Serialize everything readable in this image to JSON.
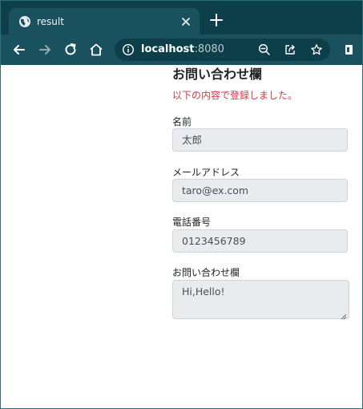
{
  "browser": {
    "tab": {
      "title": "result",
      "favicon": "globe-icon",
      "close_icon": "close-icon"
    },
    "new_tab_icon": "plus-icon",
    "toolbar": {
      "back_icon": "arrow-left-icon",
      "forward_icon": "arrow-right-icon",
      "reload_icon": "reload-icon",
      "home_icon": "home-icon",
      "info_icon": "info-icon",
      "url_host": "localhost",
      "url_port": ":8080",
      "zoom_icon": "zoom-out-icon",
      "share_icon": "share-icon",
      "bookmark_icon": "star-icon",
      "extension_icon": "extension-icon"
    },
    "colors": {
      "tabstrip": "#0d3f4b",
      "toolbar": "#19525e"
    }
  },
  "page": {
    "heading": "お問い合わせ欄",
    "notice": "以下の内容で登録しました。",
    "notice_color": "#dc3545",
    "fields": [
      {
        "label": "名前",
        "value": "太郎"
      },
      {
        "label": "メールアドレス",
        "value": "taro@ex.com"
      },
      {
        "label": "電話番号",
        "value": "0123456789"
      },
      {
        "label": "お問い合わせ欄",
        "value": "Hi,Hello!"
      }
    ]
  }
}
